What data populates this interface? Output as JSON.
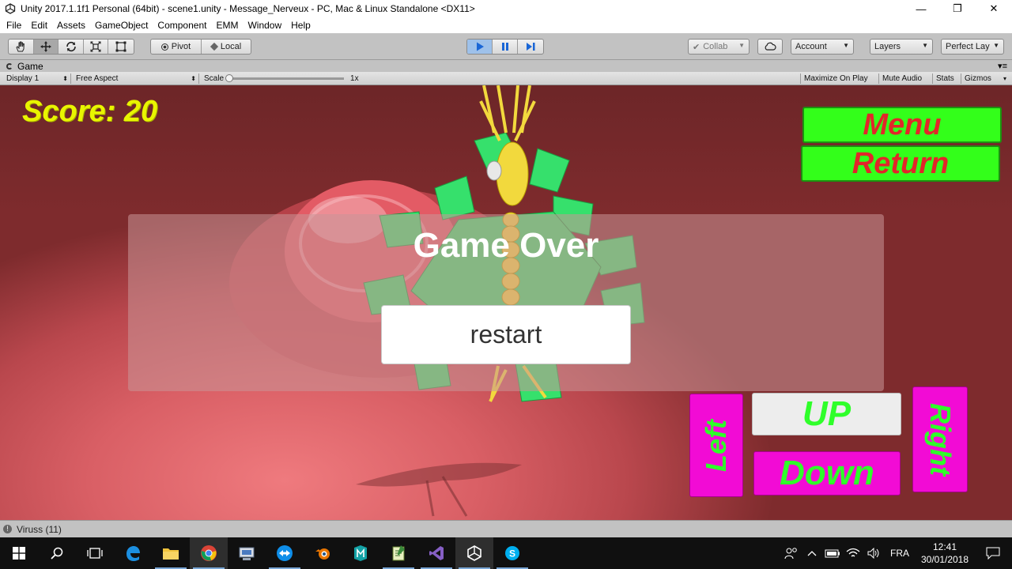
{
  "window": {
    "title": "Unity 2017.1.1f1 Personal (64bit) - scene1.unity - Message_Nerveux - PC, Mac & Linux Standalone <DX11>",
    "minimize": "—",
    "maximize": "❐",
    "close": "✕"
  },
  "menu": [
    "File",
    "Edit",
    "Assets",
    "GameObject",
    "Component",
    "EMM",
    "Window",
    "Help"
  ],
  "toolbar": {
    "pivot": "Pivot",
    "local": "Local",
    "collab": "Collab",
    "account": "Account",
    "layers": "Layers",
    "layout": "Perfect Lay"
  },
  "game_tab": {
    "label": "Game",
    "display": "Display 1",
    "aspect": "Free Aspect",
    "scale_label": "Scale",
    "scale_value": "1x",
    "maximize": "Maximize On Play",
    "mute": "Mute Audio",
    "stats": "Stats",
    "gizmos": "Gizmos"
  },
  "game": {
    "score": "Score: 20",
    "menu": "Menu",
    "return": "Return",
    "game_over": "Game Over",
    "restart": "restart",
    "up": "UP",
    "down": "Down",
    "left": "Left",
    "right": "Right"
  },
  "status": {
    "message": "Viruss (11)"
  },
  "taskbar": {
    "language": "FRA",
    "time": "12:41",
    "date": "30/01/2018"
  },
  "colors": {
    "score": "#e9f500",
    "menu_button_bg": "#33ff1a",
    "menu_button_text": "#e2262a",
    "direction_magenta": "#f20bd5",
    "direction_text": "#2fff2a",
    "play_active": "#4a8fe0"
  }
}
